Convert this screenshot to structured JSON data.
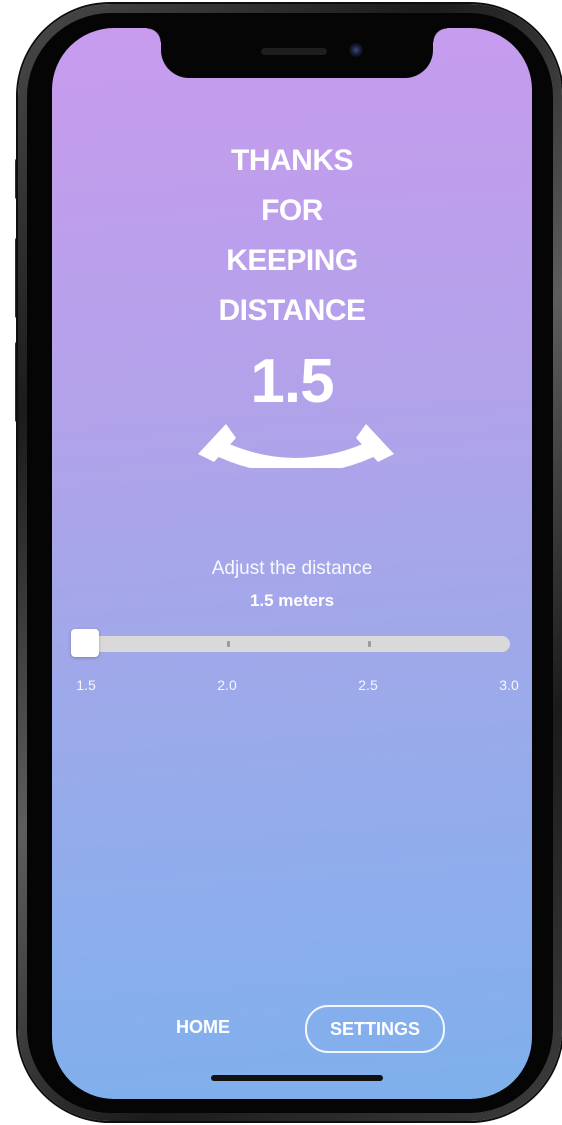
{
  "headline": {
    "line1": "THANKS",
    "line2": "FOR",
    "line3": "KEEPING",
    "line4": "DISTANCE"
  },
  "distance_display": {
    "value": "1.5"
  },
  "adjust": {
    "label": "Adjust the distance",
    "value_text": "1.5 meters"
  },
  "slider": {
    "min": 1.5,
    "max": 3.0,
    "current": 1.5,
    "scale_labels": [
      "1.5",
      "2.0",
      "2.5",
      "3.0"
    ]
  },
  "nav": {
    "home_label": "HOME",
    "settings_label": "SETTINGS",
    "active": "SETTINGS"
  },
  "colors": {
    "gradient_top": "#c89bee",
    "gradient_bottom": "#7eb0ec",
    "text": "#ffffff",
    "track": "#d9d9d9"
  }
}
